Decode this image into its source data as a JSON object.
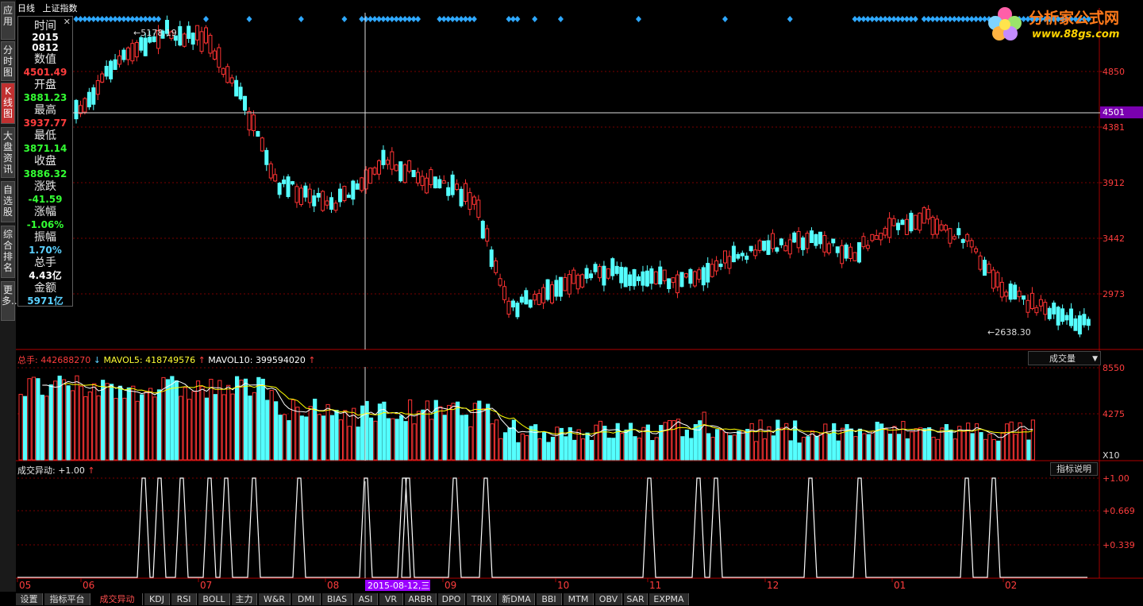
{
  "window": {
    "period": "日线",
    "index_name": "上证指数"
  },
  "left_nav": [
    {
      "label": "应用"
    },
    {
      "label": "分时图"
    },
    {
      "label": "K线图",
      "active": true
    },
    {
      "label": "大盘资讯"
    },
    {
      "label": "自选股"
    },
    {
      "label": "综合排名"
    },
    {
      "label": "更多.."
    }
  ],
  "logo": {
    "title": "分析家公式网",
    "url": "www.88gs.com"
  },
  "info_panel": {
    "close": "✕",
    "rows": [
      {
        "label": "时间",
        "value": "2015",
        "value2": "0812",
        "color": "white"
      },
      {
        "label": "数值",
        "value": "4501.49",
        "color": "red"
      },
      {
        "label": "开盘",
        "value": "3881.23",
        "color": "green"
      },
      {
        "label": "最高",
        "value": "3937.77",
        "color": "red"
      },
      {
        "label": "最低",
        "value": "3871.14",
        "color": "green"
      },
      {
        "label": "收盘",
        "value": "3886.32",
        "color": "green"
      },
      {
        "label": "涨跌",
        "value": "-41.59",
        "color": "green"
      },
      {
        "label": "涨幅",
        "value": "-1.06%",
        "color": "green"
      },
      {
        "label": "振幅",
        "value": "1.70%",
        "color": "cyan"
      },
      {
        "label": "总手",
        "value": "4.43亿",
        "color": "white"
      },
      {
        "label": "金额",
        "value": "5971亿",
        "color": "cyan"
      }
    ]
  },
  "price_axis": {
    "ticks": [
      "4850",
      "4381",
      "3912",
      "3442",
      "2973"
    ],
    "cursor_value": "4501"
  },
  "price_annotations": {
    "high": "5178.19",
    "low": "2638.30"
  },
  "volume": {
    "legend": {
      "total_label": "总手:",
      "total_value": "442688270",
      "mavol5_label": "MAVOL5:",
      "mavol5_value": "418749576",
      "mavol10_label": "MAVOL10:",
      "mavol10_value": "399594020"
    },
    "axis_ticks": [
      "8550",
      "4275"
    ],
    "unit": "X10",
    "selector": "成交量"
  },
  "indicator": {
    "legend_label": "成交异动:",
    "legend_value": "+1.00",
    "help_button": "指标说明",
    "axis_ticks": [
      "+1.00",
      "+0.669",
      "+0.339"
    ]
  },
  "date_axis": {
    "labels": [
      "05",
      "06",
      "07",
      "08",
      "09",
      "10",
      "11",
      "12",
      "01",
      "02"
    ],
    "cursor_date": "2015-08-12,三"
  },
  "bottom_tabs": [
    "设置",
    "指标平台",
    "成交异动",
    "KDJ",
    "RSI",
    "BOLL",
    "主力",
    "W&R",
    "DMI",
    "BIAS",
    "ASI",
    "VR",
    "ARBR",
    "DPO",
    "TRIX",
    "新DMA",
    "BBI",
    "MTM",
    "OBV",
    "SAR",
    "EXPMA"
  ],
  "active_tab": "成交异动",
  "colors": {
    "up": "#ff3333",
    "down": "#55ffff",
    "grid": "#7a0000",
    "axis": "#a00000",
    "signal_diamond": "#2ea8ff",
    "mavol5": "#ffffff",
    "mavol10": "#ffff00",
    "cursor_date_bg": "#9a00ff"
  }
}
